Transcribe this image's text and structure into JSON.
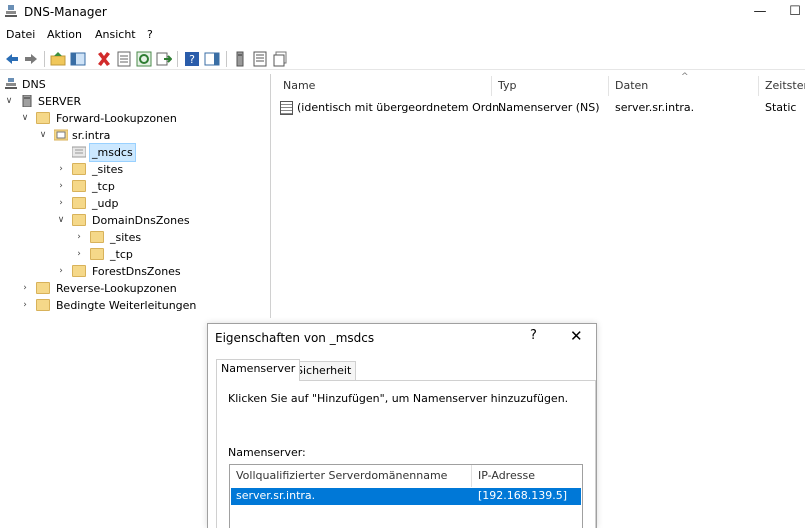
{
  "window": {
    "title": "DNS-Manager",
    "minimize_glyph": "—",
    "maximize_glyph": "☐"
  },
  "menu": {
    "items": [
      "Datei",
      "Aktion",
      "Ansicht",
      "?"
    ]
  },
  "toolbar": {
    "icons": [
      "back-arrow-icon",
      "forward-arrow-icon",
      "up-folder-icon",
      "show-hide-tree-icon",
      "delete-icon",
      "properties-icon",
      "refresh-icon",
      "export-list-icon",
      "help-icon",
      "action-pane-icon",
      "server-icon",
      "record-icon",
      "record-stack-icon"
    ]
  },
  "tree": {
    "root": "DNS",
    "server": "SERVER",
    "forward": "Forward-Lookupzonen",
    "zone": "sr.intra",
    "msdcs": "_msdcs",
    "sites": "_sites",
    "tcp": "_tcp",
    "udp": "_udp",
    "domaindns": "DomainDnsZones",
    "dd_sites": "_sites",
    "dd_tcp": "_tcp",
    "forestdns": "ForestDnsZones",
    "reverse": "Reverse-Lookupzonen",
    "conditional": "Bedingte Weiterleitungen"
  },
  "list": {
    "headers": {
      "name": "Name",
      "type": "Typ",
      "data": "Daten",
      "timestamp": "Zeitstem"
    },
    "rows": [
      {
        "name": "(identisch mit übergeordnetem Ordn...",
        "type": "Namenserver (NS)",
        "data": "server.sr.intra.",
        "timestamp": "Static"
      }
    ]
  },
  "dialog": {
    "title": "Eigenschaften von _msdcs",
    "help": "?",
    "close": "✕",
    "tabs": [
      "Namenserver",
      "Sicherheit"
    ],
    "instruction": "Klicken Sie auf \"Hinzufügen\", um Namenserver hinzuzufügen.",
    "ns_label": "Namenserver:",
    "grid_headers": {
      "fqdn": "Vollqualifizierter Serverdomänenname",
      "ip": "IP-Adresse"
    },
    "grid_rows": [
      {
        "fqdn": "server.sr.intra.",
        "ip": "[192.168.139.5]"
      }
    ]
  }
}
